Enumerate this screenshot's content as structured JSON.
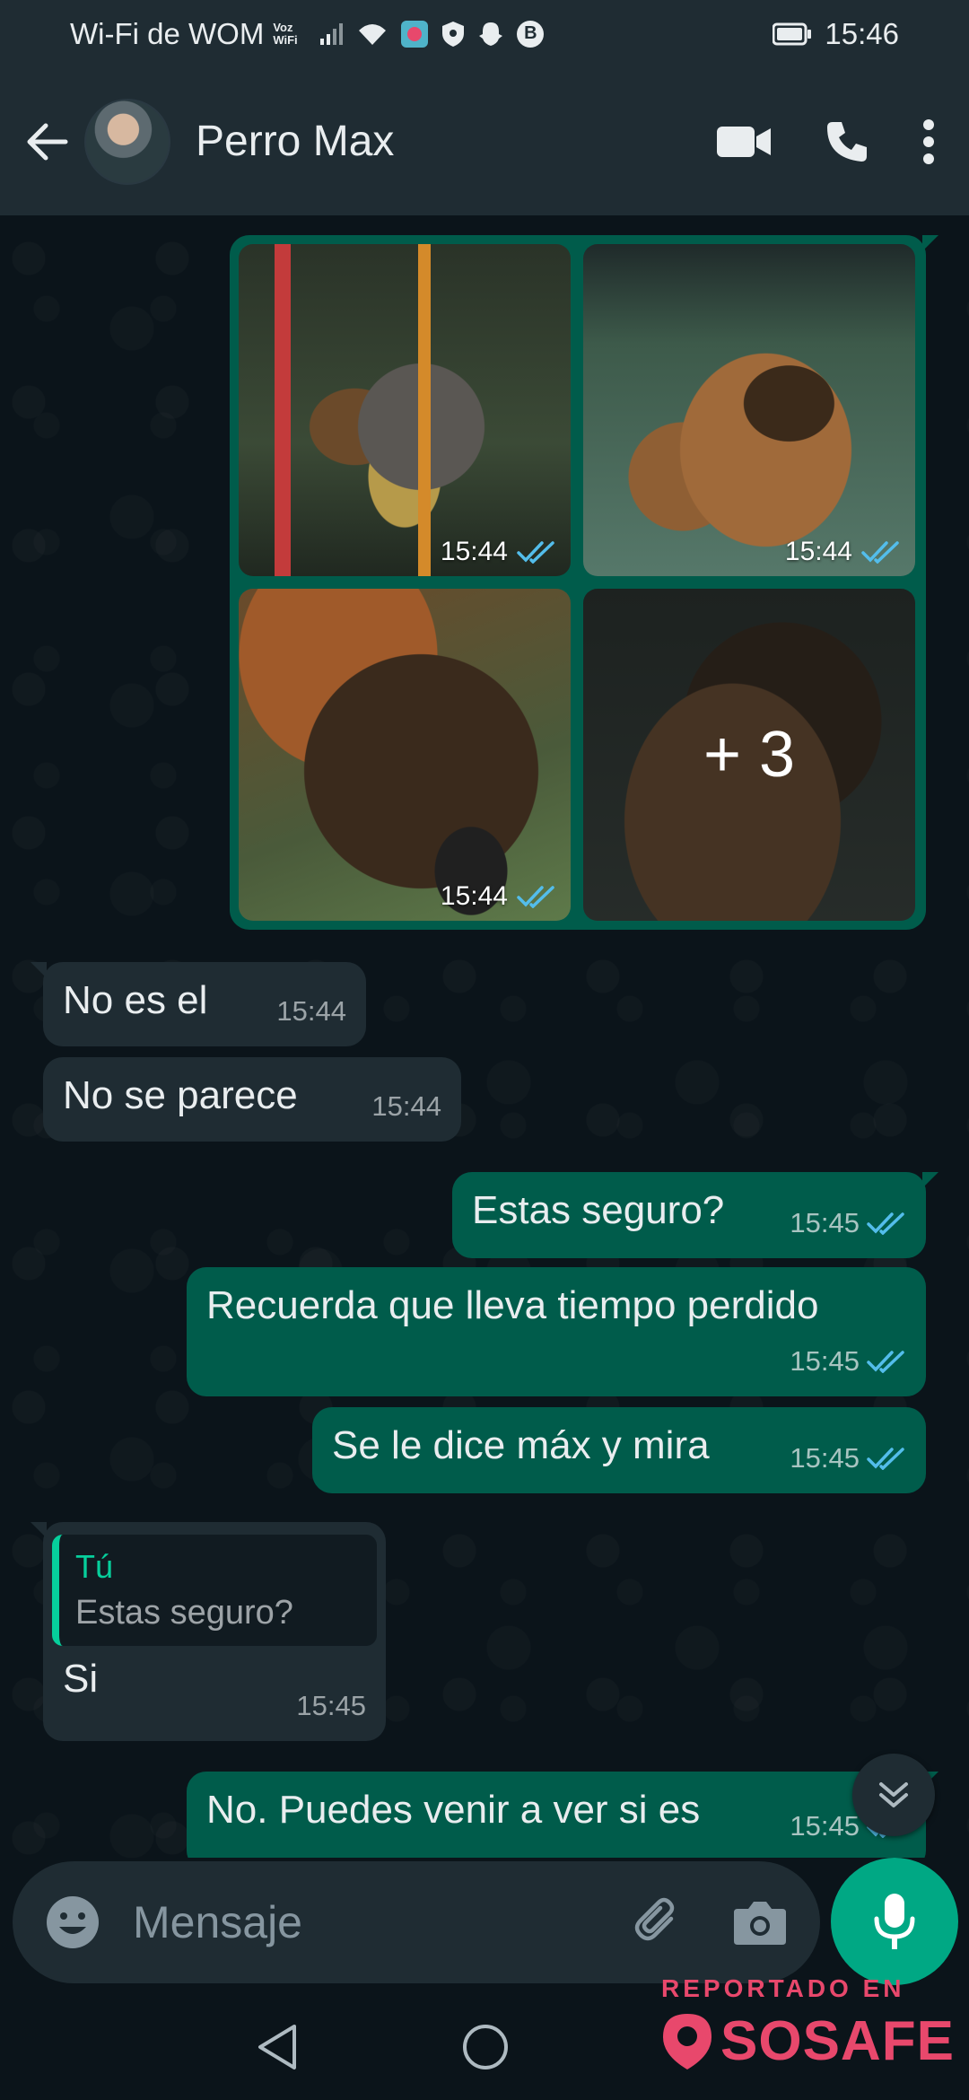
{
  "status_bar": {
    "carrier": "Wi-Fi de WOM",
    "voz_wifi": "Voz WiFi",
    "badge": "B",
    "time": "15:46"
  },
  "header": {
    "contact_name": "Perro Max"
  },
  "media": {
    "photos": [
      {
        "time": "15:44"
      },
      {
        "time": "15:44"
      },
      {
        "time": "15:44"
      }
    ],
    "more_count": "+ 3"
  },
  "messages": [
    {
      "text": "No es el",
      "time": "15:44",
      "direction": "in"
    },
    {
      "text": "No se parece",
      "time": "15:44",
      "direction": "in"
    },
    {
      "text": "Estas seguro?",
      "time": "15:45",
      "direction": "out"
    },
    {
      "text": "Recuerda que lleva tiempo perdido",
      "time": "15:45",
      "direction": "out"
    },
    {
      "text": "Se le dice máx y mira",
      "time": "15:45",
      "direction": "out"
    },
    {
      "text": "Si",
      "time": "15:45",
      "direction": "in",
      "quote_author": "Tú",
      "quote_text": "Estas seguro?"
    },
    {
      "text": "No. Puedes venir a ver si es",
      "time": "15:45",
      "direction": "out"
    }
  ],
  "input": {
    "placeholder": "Mensaje"
  },
  "watermark": {
    "top": "REPORTADO EN",
    "brand": "SOSAFE"
  },
  "colors": {
    "outgoing_bubble": "#005c4b",
    "incoming_bubble": "#1f2c33",
    "read_ticks": "#53bdeb",
    "accent": "#00a884",
    "watermark": "#e8486c"
  }
}
